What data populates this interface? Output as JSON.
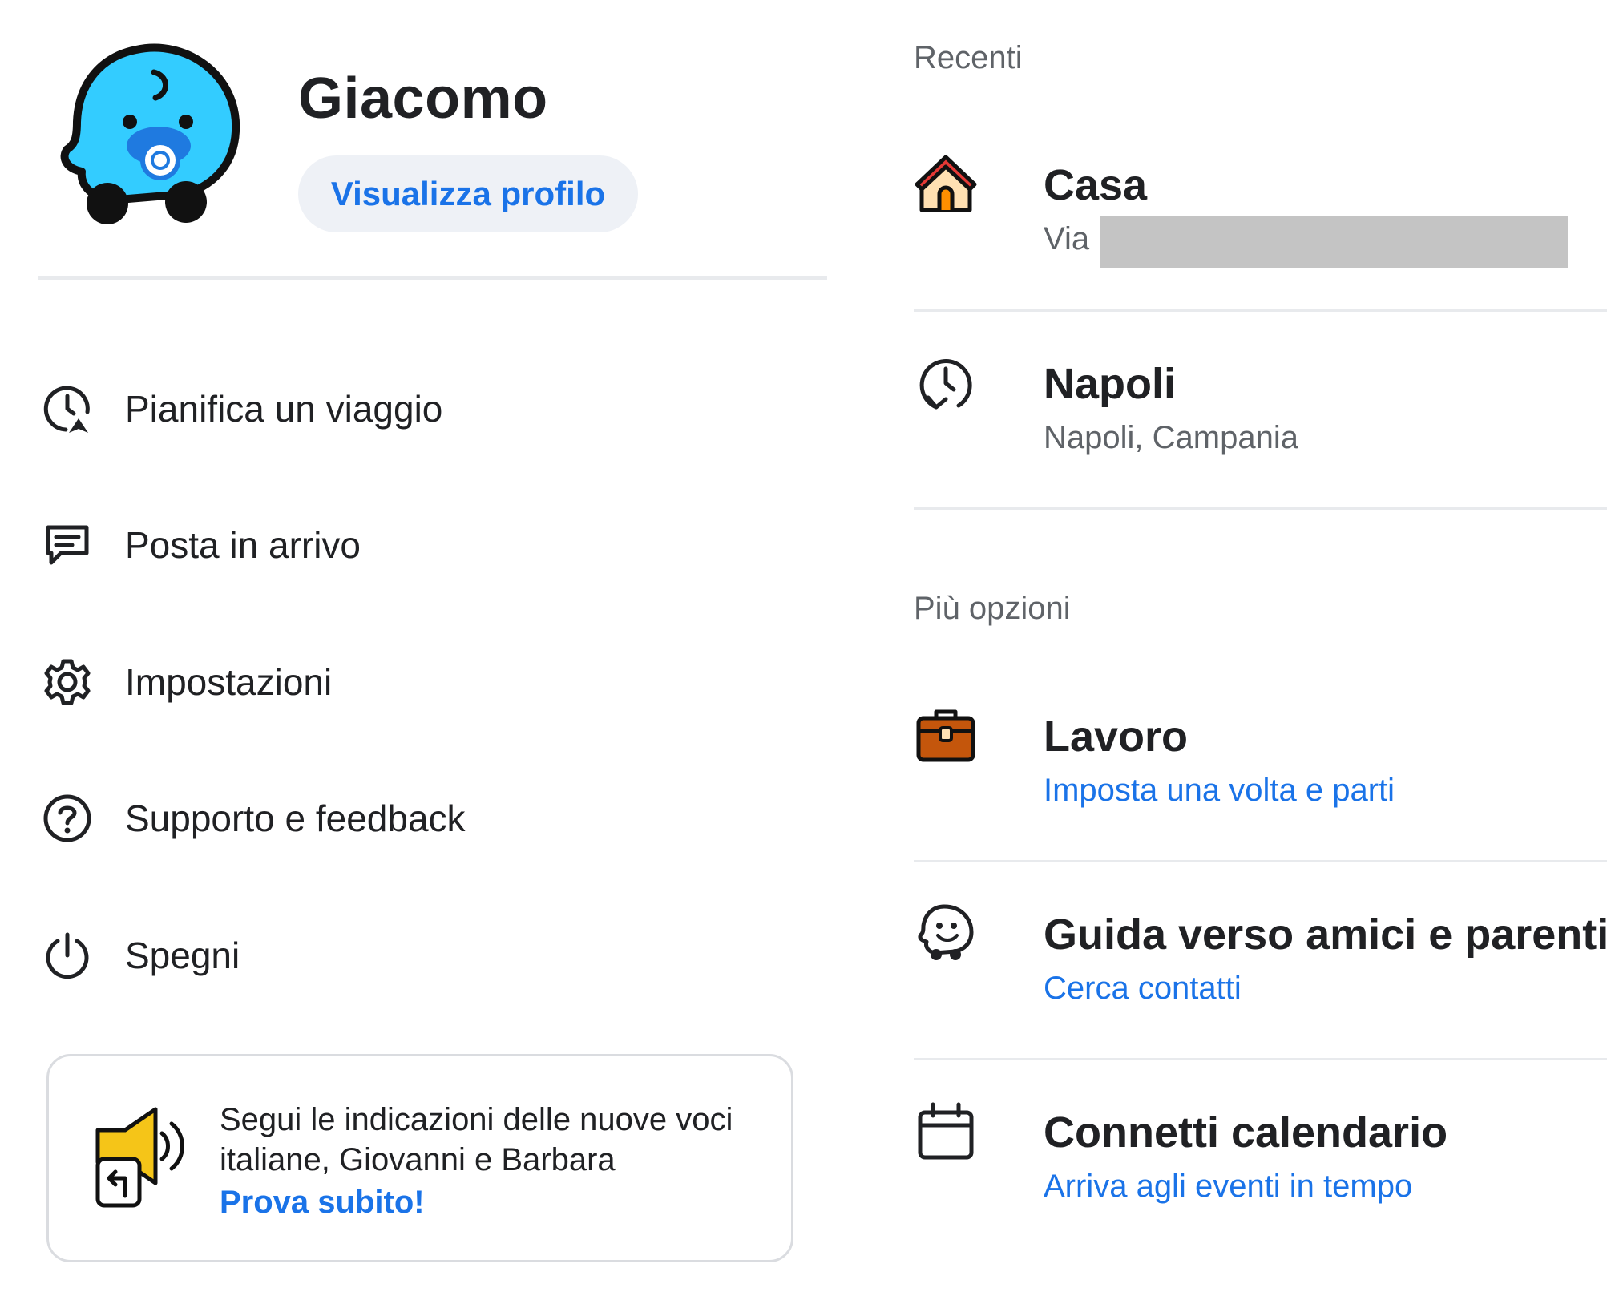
{
  "profile": {
    "name": "Giacomo",
    "view_profile_label": "Visualizza profilo",
    "avatar_icon": "waze-baby-avatar-icon"
  },
  "menu": {
    "items": [
      {
        "label": "Pianifica un viaggio",
        "icon": "plan-trip-icon"
      },
      {
        "label": "Posta in arrivo",
        "icon": "inbox-icon"
      },
      {
        "label": "Impostazioni",
        "icon": "gear-icon"
      },
      {
        "label": "Supporto e feedback",
        "icon": "help-icon"
      },
      {
        "label": "Spegni",
        "icon": "power-icon"
      }
    ]
  },
  "promo": {
    "text": "Segui le indicazioni delle nuove voci italiane, Giovanni e Barbara",
    "link": "Prova subito!",
    "icon": "megaphone-icon"
  },
  "recent": {
    "title": "Recenti",
    "items": [
      {
        "title": "Casa",
        "subtitle": "Via",
        "icon": "home-icon"
      },
      {
        "title": "Napoli",
        "subtitle": "Napoli, Campania",
        "icon": "history-icon"
      }
    ]
  },
  "more": {
    "title": "Più opzioni",
    "items": [
      {
        "title": "Lavoro",
        "subtitle": "Imposta una volta e parti",
        "icon": "briefcase-icon"
      },
      {
        "title": "Guida verso amici e parenti",
        "subtitle": "Cerca contatti",
        "icon": "waze-friend-icon"
      },
      {
        "title": "Connetti calendario",
        "subtitle": "Arriva agli eventi in tempo",
        "icon": "calendar-icon"
      }
    ]
  },
  "colors": {
    "accent": "#1a73e8",
    "avatar": "#33ccff",
    "home_roof": "#e53935",
    "briefcase": "#c4560c",
    "megaphone": "#f5c518"
  }
}
